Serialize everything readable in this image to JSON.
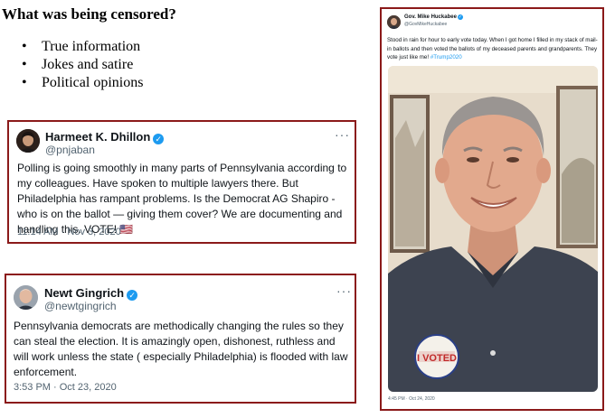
{
  "heading": "What was being censored?",
  "bullets": [
    "True information",
    "Jokes and satire",
    "Political opinions"
  ],
  "tweets": [
    {
      "name": "Harmeet K. Dhillon",
      "handle": "@pnjaban",
      "text": "Polling is going smoothly in many parts of Pennsylvania according to my colleagues. Have spoken to multiple lawyers there. But Philadelphia has rampant problems. Is the Democrat AG Shapiro - who is on the ballot — giving them cover? We are documenting and handling this. VOTE! 🇺🇸",
      "time": "11:14 AM · Nov 3, 2020",
      "more": "···"
    },
    {
      "name": "Newt Gingrich",
      "handle": "@newtgingrich",
      "text": "Pennsylvania democrats are methodically changing the rules so they can steal the election. It is amazingly open, dishonest, ruthless and will work unless the state ( especially Philadelphia) is flooded with law enforcement.",
      "time": "3:53 PM · Oct 23, 2020",
      "more": "···"
    },
    {
      "name": "Gov. Mike Huckabee",
      "handle": "@GovMikeHuckabee",
      "text": "Stood in rain for hour to early vote today. When I got home I filled in my stack of mail-in ballots and then voted the ballots of my deceased parents and grandparents.  They vote just like me! ",
      "hashtag": "#Trump2020",
      "time": "4:45 PM · Oct 24, 2020",
      "sticker_text": "I VOTED"
    }
  ],
  "colors": {
    "frame": "#8b1a1a",
    "verified": "#1d9bf0",
    "muted": "#536471"
  }
}
